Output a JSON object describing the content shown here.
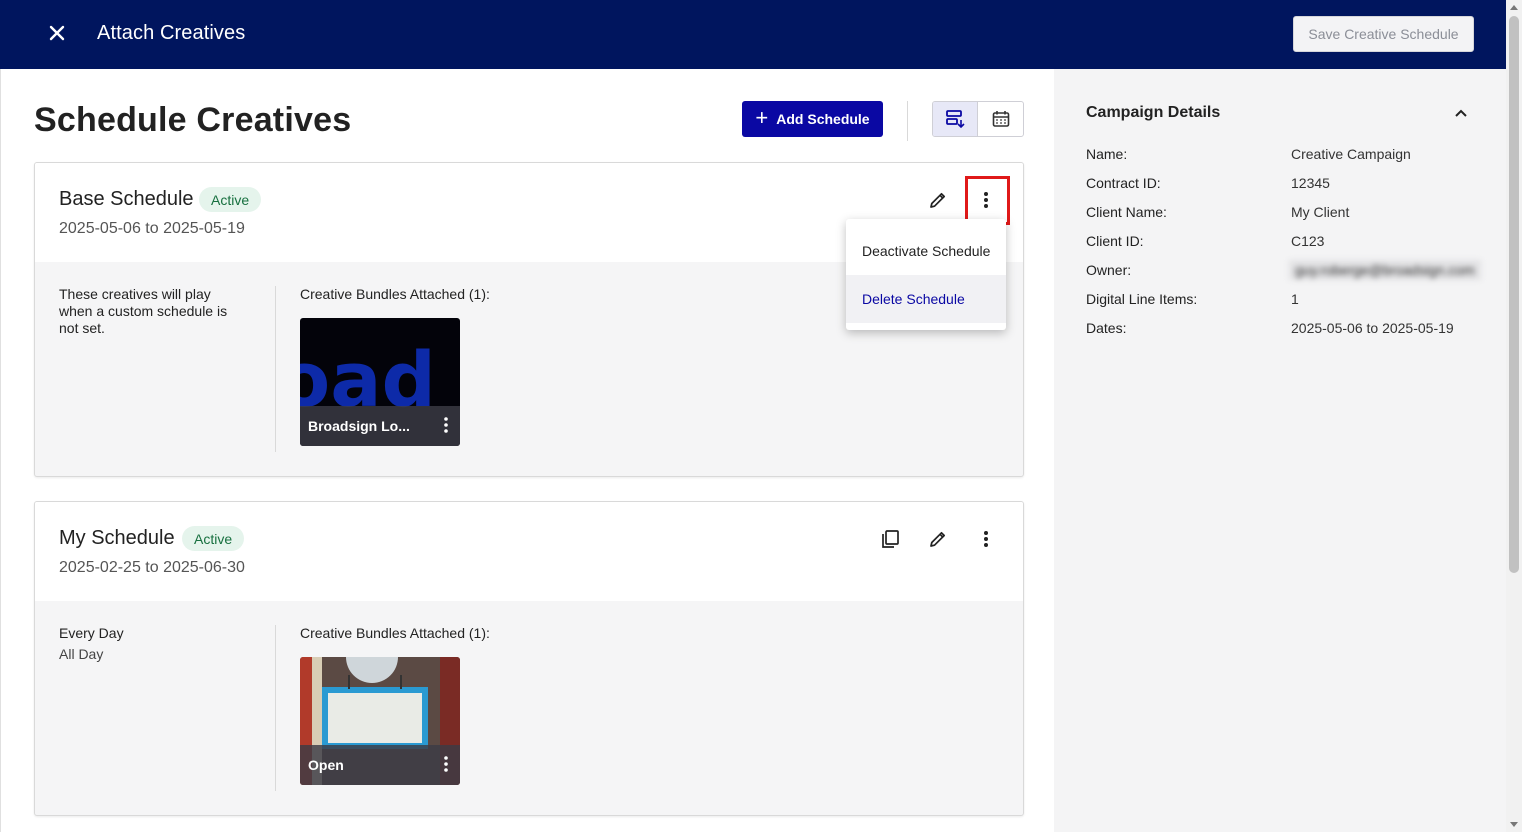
{
  "header": {
    "title": "Attach Creatives",
    "save_label": "Save Creative Schedule"
  },
  "main": {
    "title": "Schedule Creatives",
    "add_label": "Add Schedule"
  },
  "schedules": [
    {
      "name": "Base Schedule",
      "status": "Active",
      "dates": "2025-05-06 to 2025-05-19",
      "description": "These creatives will play when a custom schedule is not set.",
      "bundles_label": "Creative Bundles Attached (1):",
      "bundle_name": "Broadsign Lo..."
    },
    {
      "name": "My Schedule",
      "status": "Active",
      "dates": "2025-02-25 to 2025-06-30",
      "days": "Every Day",
      "time": "All Day",
      "bundles_label": "Creative Bundles Attached (1):",
      "bundle_name": "Open"
    }
  ],
  "menu": {
    "items": [
      "Deactivate Schedule",
      "Delete Schedule"
    ]
  },
  "campaign": {
    "title": "Campaign Details",
    "fields": [
      {
        "key": "Name:",
        "value": "Creative Campaign"
      },
      {
        "key": "Contract ID:",
        "value": "12345"
      },
      {
        "key": "Client Name:",
        "value": "My Client"
      },
      {
        "key": "Client ID:",
        "value": "C123"
      },
      {
        "key": "Owner:",
        "value": "guy.roberge@broadsign.com"
      },
      {
        "key": "Digital Line Items:",
        "value": "1"
      },
      {
        "key": "Dates:",
        "value": "2025-05-06 to 2025-05-19"
      }
    ]
  },
  "colors": {
    "header_bg": "#00155e",
    "primary": "#0a08a3",
    "badge_bg": "#e5f4ec",
    "badge_text": "#17703f",
    "highlight": "#e01919"
  }
}
